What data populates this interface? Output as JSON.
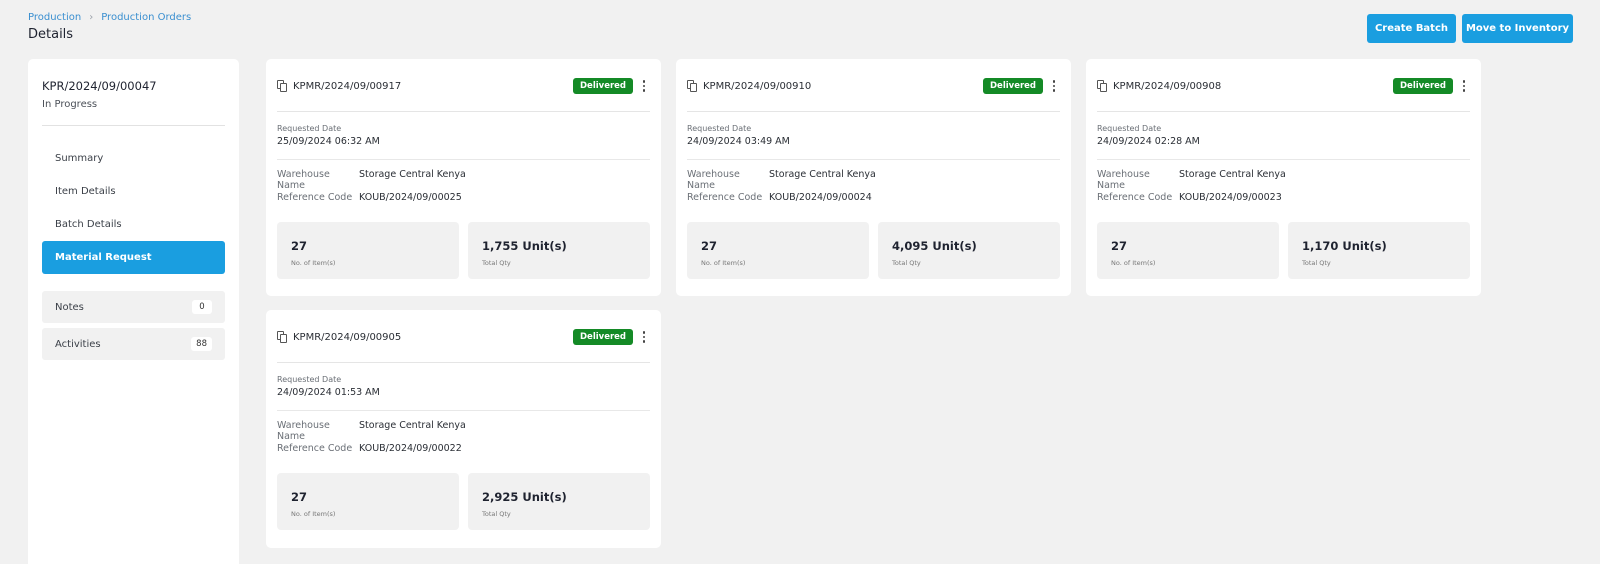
{
  "breadcrumb": {
    "items": [
      "Production",
      "Production Orders"
    ]
  },
  "page": {
    "title": "Details"
  },
  "actions": {
    "create_batch": "Create Batch",
    "move_to_inventory": "Move to Inventory"
  },
  "sidebar": {
    "order_code": "KPR/2024/09/00047",
    "status": "In Progress",
    "nav": [
      {
        "label": "Summary",
        "active": false
      },
      {
        "label": "Item Details",
        "active": false
      },
      {
        "label": "Batch Details",
        "active": false
      },
      {
        "label": "Material Request",
        "active": true
      }
    ],
    "extra": [
      {
        "label": "Notes",
        "count": "0"
      },
      {
        "label": "Activities",
        "count": "88"
      }
    ]
  },
  "card_labels": {
    "requested_date": "Requested Date",
    "warehouse_name": "Warehouse Name",
    "reference_code": "Reference Code",
    "items_count": "No. of Item(s)",
    "total_qty": "Total Qty"
  },
  "cards": [
    {
      "code": "KPMR/2024/09/00917",
      "status": "Delivered",
      "requested_date": "25/09/2024 06:32 AM",
      "warehouse": "Storage Central Kenya",
      "reference": "KOUB/2024/09/00025",
      "items": "27",
      "qty": "1,755 Unit(s)"
    },
    {
      "code": "KPMR/2024/09/00910",
      "status": "Delivered",
      "requested_date": "24/09/2024 03:49 AM",
      "warehouse": "Storage Central Kenya",
      "reference": "KOUB/2024/09/00024",
      "items": "27",
      "qty": "4,095 Unit(s)"
    },
    {
      "code": "KPMR/2024/09/00908",
      "status": "Delivered",
      "requested_date": "24/09/2024 02:28 AM",
      "warehouse": "Storage Central Kenya",
      "reference": "KOUB/2024/09/00023",
      "items": "27",
      "qty": "1,170 Unit(s)"
    },
    {
      "code": "KPMR/2024/09/00905",
      "status": "Delivered",
      "requested_date": "24/09/2024 01:53 AM",
      "warehouse": "Storage Central Kenya",
      "reference": "KOUB/2024/09/00022",
      "items": "27",
      "qty": "2,925 Unit(s)"
    }
  ],
  "colors": {
    "primary": "#1a9ee0",
    "delivered": "#148a26",
    "background": "#f1f1f1"
  },
  "icons": {
    "card": "document-copy-icon",
    "menu": "kebab-menu-icon",
    "breadcrumb_separator": "chevron-right-icon"
  }
}
